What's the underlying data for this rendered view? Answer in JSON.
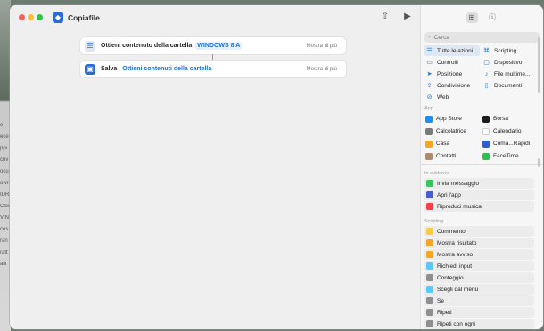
{
  "desktop": {
    "side_fragments": [
      "e",
      "ece",
      "ppi",
      "criv",
      "ocu",
      "owr",
      "IDR",
      "Clou",
      "VINI",
      "ces",
      "ran",
      "ratt",
      "alli"
    ]
  },
  "window": {
    "title": "Copiafile"
  },
  "actions": [
    {
      "label": "Ottieni contenuto della cartella",
      "token": "WINDOWS 8 A",
      "more": "Mostra di più"
    },
    {
      "label": "Salva",
      "token": "Ottieni contenuti della cartella",
      "more": "Mostra di più"
    }
  ],
  "panel": {
    "search_placeholder": "Cerca",
    "categories": [
      {
        "label": "Tutte le azioni",
        "icon": "list-icon",
        "glyph": "☰"
      },
      {
        "label": "Scripting",
        "icon": "scripting-icon",
        "glyph": "⌘"
      },
      {
        "label": "Controlli",
        "icon": "controls-icon",
        "glyph": "▭"
      },
      {
        "label": "Dispositivo",
        "icon": "device-icon",
        "glyph": "▢"
      },
      {
        "label": "Posizione",
        "icon": "location-icon",
        "glyph": "➤"
      },
      {
        "label": "File multime...",
        "icon": "media-icon",
        "glyph": "♪"
      },
      {
        "label": "Condivisione",
        "icon": "share-icon",
        "glyph": "⇪"
      },
      {
        "label": "Documenti",
        "icon": "document-icon",
        "glyph": "▯"
      },
      {
        "label": "Web",
        "icon": "web-icon",
        "glyph": "⊘"
      }
    ],
    "apps_header": "App",
    "apps": [
      {
        "label": "App Store",
        "color": "#1f8cf0"
      },
      {
        "label": "Borsa",
        "color": "#1c1c1e"
      },
      {
        "label": "Calcolatrice",
        "color": "#7a7a7a"
      },
      {
        "label": "Calendario",
        "color": "#ffffff"
      },
      {
        "label": "Casa",
        "color": "#f5a623"
      },
      {
        "label": "Coma...Rapidi",
        "color": "#2b5fd9"
      },
      {
        "label": "Contatti",
        "color": "#b08a68"
      },
      {
        "label": "FaceTime",
        "color": "#2fbf4a"
      }
    ],
    "featured_header": "In evidenza",
    "featured": [
      {
        "label": "Invia messaggio",
        "color": "#34c759"
      },
      {
        "label": "Apri l'app",
        "color": "#4a5bd6"
      },
      {
        "label": "Riproduci musica",
        "color": "#fc3c44"
      }
    ],
    "scripting_header": "Scripting",
    "scripting": [
      {
        "label": "Commento",
        "color": "#f7cd46"
      },
      {
        "label": "Mostra risultato",
        "color": "#f5a623"
      },
      {
        "label": "Mostra avviso",
        "color": "#f5a623"
      },
      {
        "label": "Richiedi input",
        "color": "#5ac8fa"
      },
      {
        "label": "Conteggio",
        "color": "#8e8e93"
      },
      {
        "label": "Scegli dal menu",
        "color": "#5ac8fa"
      },
      {
        "label": "Se",
        "color": "#8e8e93"
      },
      {
        "label": "Ripeti",
        "color": "#8e8e93"
      },
      {
        "label": "Ripeti con ogni",
        "color": "#8e8e93"
      }
    ]
  },
  "colors": {
    "accent": "#1a6fe0",
    "close": "#fe5f57",
    "minimize": "#febc2e",
    "zoom": "#28c840"
  }
}
